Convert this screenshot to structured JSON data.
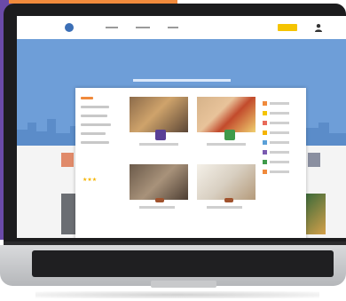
{
  "colors": {
    "hero_blue": "#6e9ed8",
    "accent_yellow": "#f5c400",
    "accent_orange": "#f08a3c",
    "brand_purple": "#6a4aa8",
    "laptop_dark": "#1c1c1e"
  },
  "icons": {
    "logo": "logo-icon",
    "user": "user-icon",
    "search": "search-icon",
    "stars": "star-rating-icon"
  },
  "stars": "★★★"
}
